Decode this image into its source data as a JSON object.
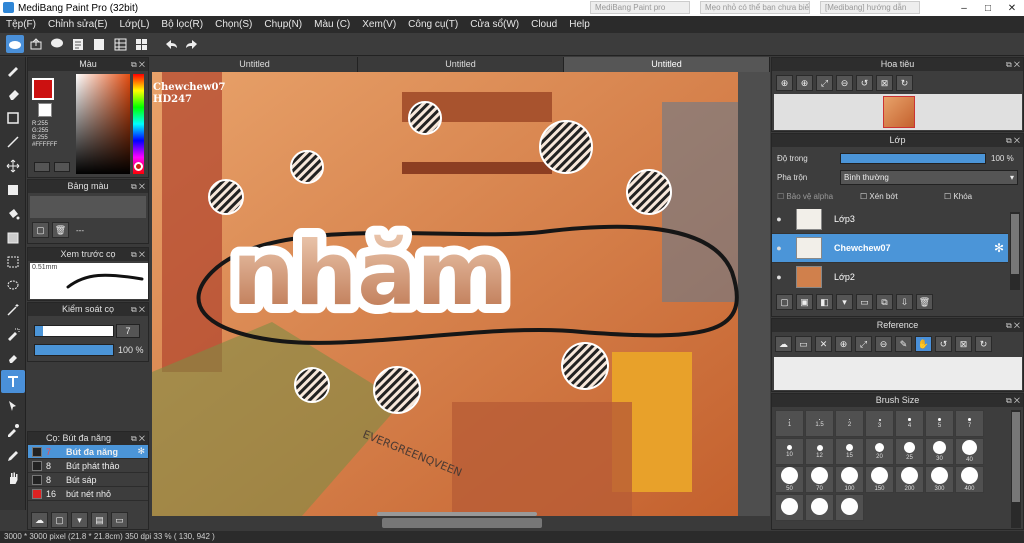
{
  "app": {
    "title": "MediBang Paint Pro (32bit)",
    "window_controls": [
      "–",
      "□",
      "✕"
    ],
    "ghost_tabs": [
      "MediBang Paint pro",
      "Mẹo nhỏ có thể bạn chưa biết...",
      "[Medibang] hướng dẫn"
    ]
  },
  "menu": [
    "Tệp(F)",
    "Chỉnh sửa(E)",
    "Lớp(L)",
    "Bộ lọc(R)",
    "Chọn(S)",
    "Chụp(N)",
    "Màu (C)",
    "Xem(V)",
    "Công cụ(T)",
    "Cửa sổ(W)",
    "Cloud",
    "Help"
  ],
  "toolbar_icons": [
    "cloud-icon",
    "share-icon",
    "comment-icon",
    "document-icon",
    "page-icon",
    "grid-icon",
    "layout-icon",
    "undo-icon",
    "redo-icon"
  ],
  "tools": [
    "brush-icon",
    "eraser-icon",
    "rectangle-icon",
    "line-icon",
    "move-icon",
    "fill-rect-icon",
    "bucket-icon",
    "gradient-icon",
    "select-rect-icon",
    "lasso-icon",
    "magic-wand-icon",
    "select-pen-icon",
    "select-eraser-icon",
    "text-icon",
    "operation-icon",
    "eyedropper-icon",
    "pen-icon",
    "hand-icon"
  ],
  "color_panel": {
    "title": "Màu",
    "r": "R:255",
    "g": "G:255",
    "b": "B:255",
    "hex": "#FFFFFF",
    "primary": "#cc1111",
    "secondary": "#ffffff"
  },
  "palette_panel": {
    "title": "Bảng màu",
    "empty_text": "---"
  },
  "preview_panel": {
    "title": "Xem trước cọ",
    "size": "0.51mm"
  },
  "brush_control": {
    "title": "Kiểm soát cọ",
    "size": "7",
    "opacity": "100 %"
  },
  "brush_list": {
    "title": "Cọ: Bút đa năng",
    "items": [
      {
        "size": "7",
        "name": "Bút đa năng",
        "color": "#222222",
        "selected": true
      },
      {
        "size": "8",
        "name": "Bút phát thảo",
        "color": "#222222",
        "selected": false
      },
      {
        "size": "8",
        "name": "Bút sáp",
        "color": "#222222",
        "selected": false
      },
      {
        "size": "16",
        "name": "bút nét nhỏ",
        "color": "#dd2222",
        "selected": false
      }
    ]
  },
  "doc_tabs": [
    {
      "label": "Untitled",
      "active": false
    },
    {
      "label": "Untitled",
      "active": false
    },
    {
      "label": "Untitled",
      "active": true
    }
  ],
  "canvas": {
    "watermark_1": "Chewchew07",
    "watermark_2": "HD247",
    "headline": "nhăm",
    "sign": "EVERGREENQVEEN"
  },
  "navigator": {
    "title": "Hoa tiêu"
  },
  "layer_panel": {
    "title": "Lớp",
    "opacity_label": "Độ trong",
    "opacity_value": "100 %",
    "blend_label": "Pha trộn",
    "blend_value": "Bình thường",
    "protect_alpha": "Bảo vệ alpha",
    "clipping": "Xén bớt",
    "lock": "Khóa",
    "layers": [
      {
        "name": "Lớp3",
        "selected": false
      },
      {
        "name": "Chewchew07",
        "selected": true
      },
      {
        "name": "Lớp2",
        "selected": false
      }
    ]
  },
  "reference_panel": {
    "title": "Reference"
  },
  "brush_size_panel": {
    "title": "Brush Size",
    "sizes": [
      "1",
      "1.5",
      "2",
      "3",
      "4",
      "5",
      "7",
      "10",
      "12",
      "15",
      "20",
      "25",
      "30",
      "40",
      "50",
      "70",
      "100",
      "150",
      "200",
      "300",
      "400",
      "",
      "",
      ""
    ]
  },
  "status": {
    "text": "3000 * 3000 pixel   (21.8 * 21.8cm)   350 dpi   33 %   ( 130, 942 )"
  }
}
